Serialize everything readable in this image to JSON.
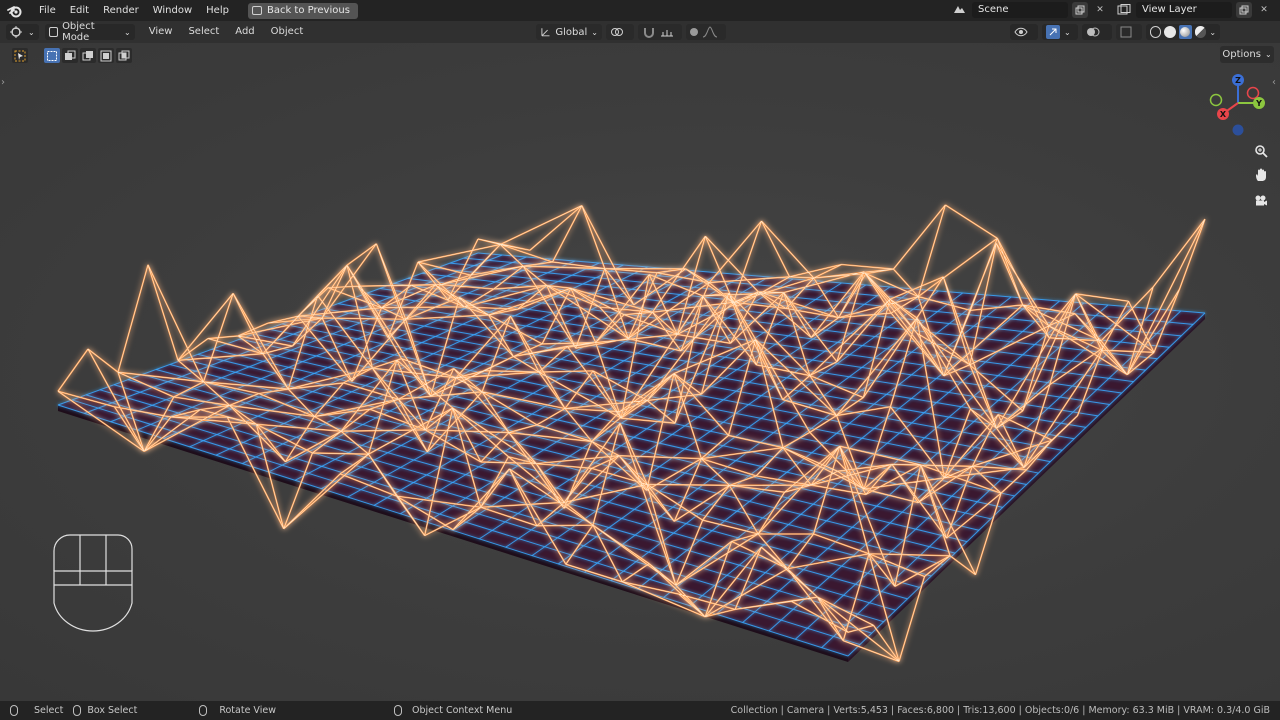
{
  "menu": {
    "file": "File",
    "edit": "Edit",
    "render": "Render",
    "window": "Window",
    "help": "Help",
    "back_to_previous": "Back to Previous"
  },
  "scene": {
    "name": "Scene"
  },
  "view_layer": {
    "name": "View Layer"
  },
  "header": {
    "mode": "Object Mode",
    "view": "View",
    "select": "Select",
    "add": "Add",
    "object": "Object",
    "transform_orientation": "Global"
  },
  "viewport": {
    "options_label": "Options",
    "gizmo": {
      "z": "Z",
      "y": "Y",
      "x": "X"
    }
  },
  "statusbar": {
    "select": "Select",
    "box_select": "Box Select",
    "rotate_view": "Rotate View",
    "context_menu": "Object Context Menu",
    "stats": "Collection | Camera | Verts:5,453 | Faces:6,800 | Tris:13,600 | Objects:0/6 | Memory: 63.3 MiB | VRAM: 0.3/4.0 GiB"
  },
  "colors": {
    "grid_line": "#3aa8ff",
    "wire_glow": "#ff9a4a",
    "plane_fill": "#3a1830"
  }
}
